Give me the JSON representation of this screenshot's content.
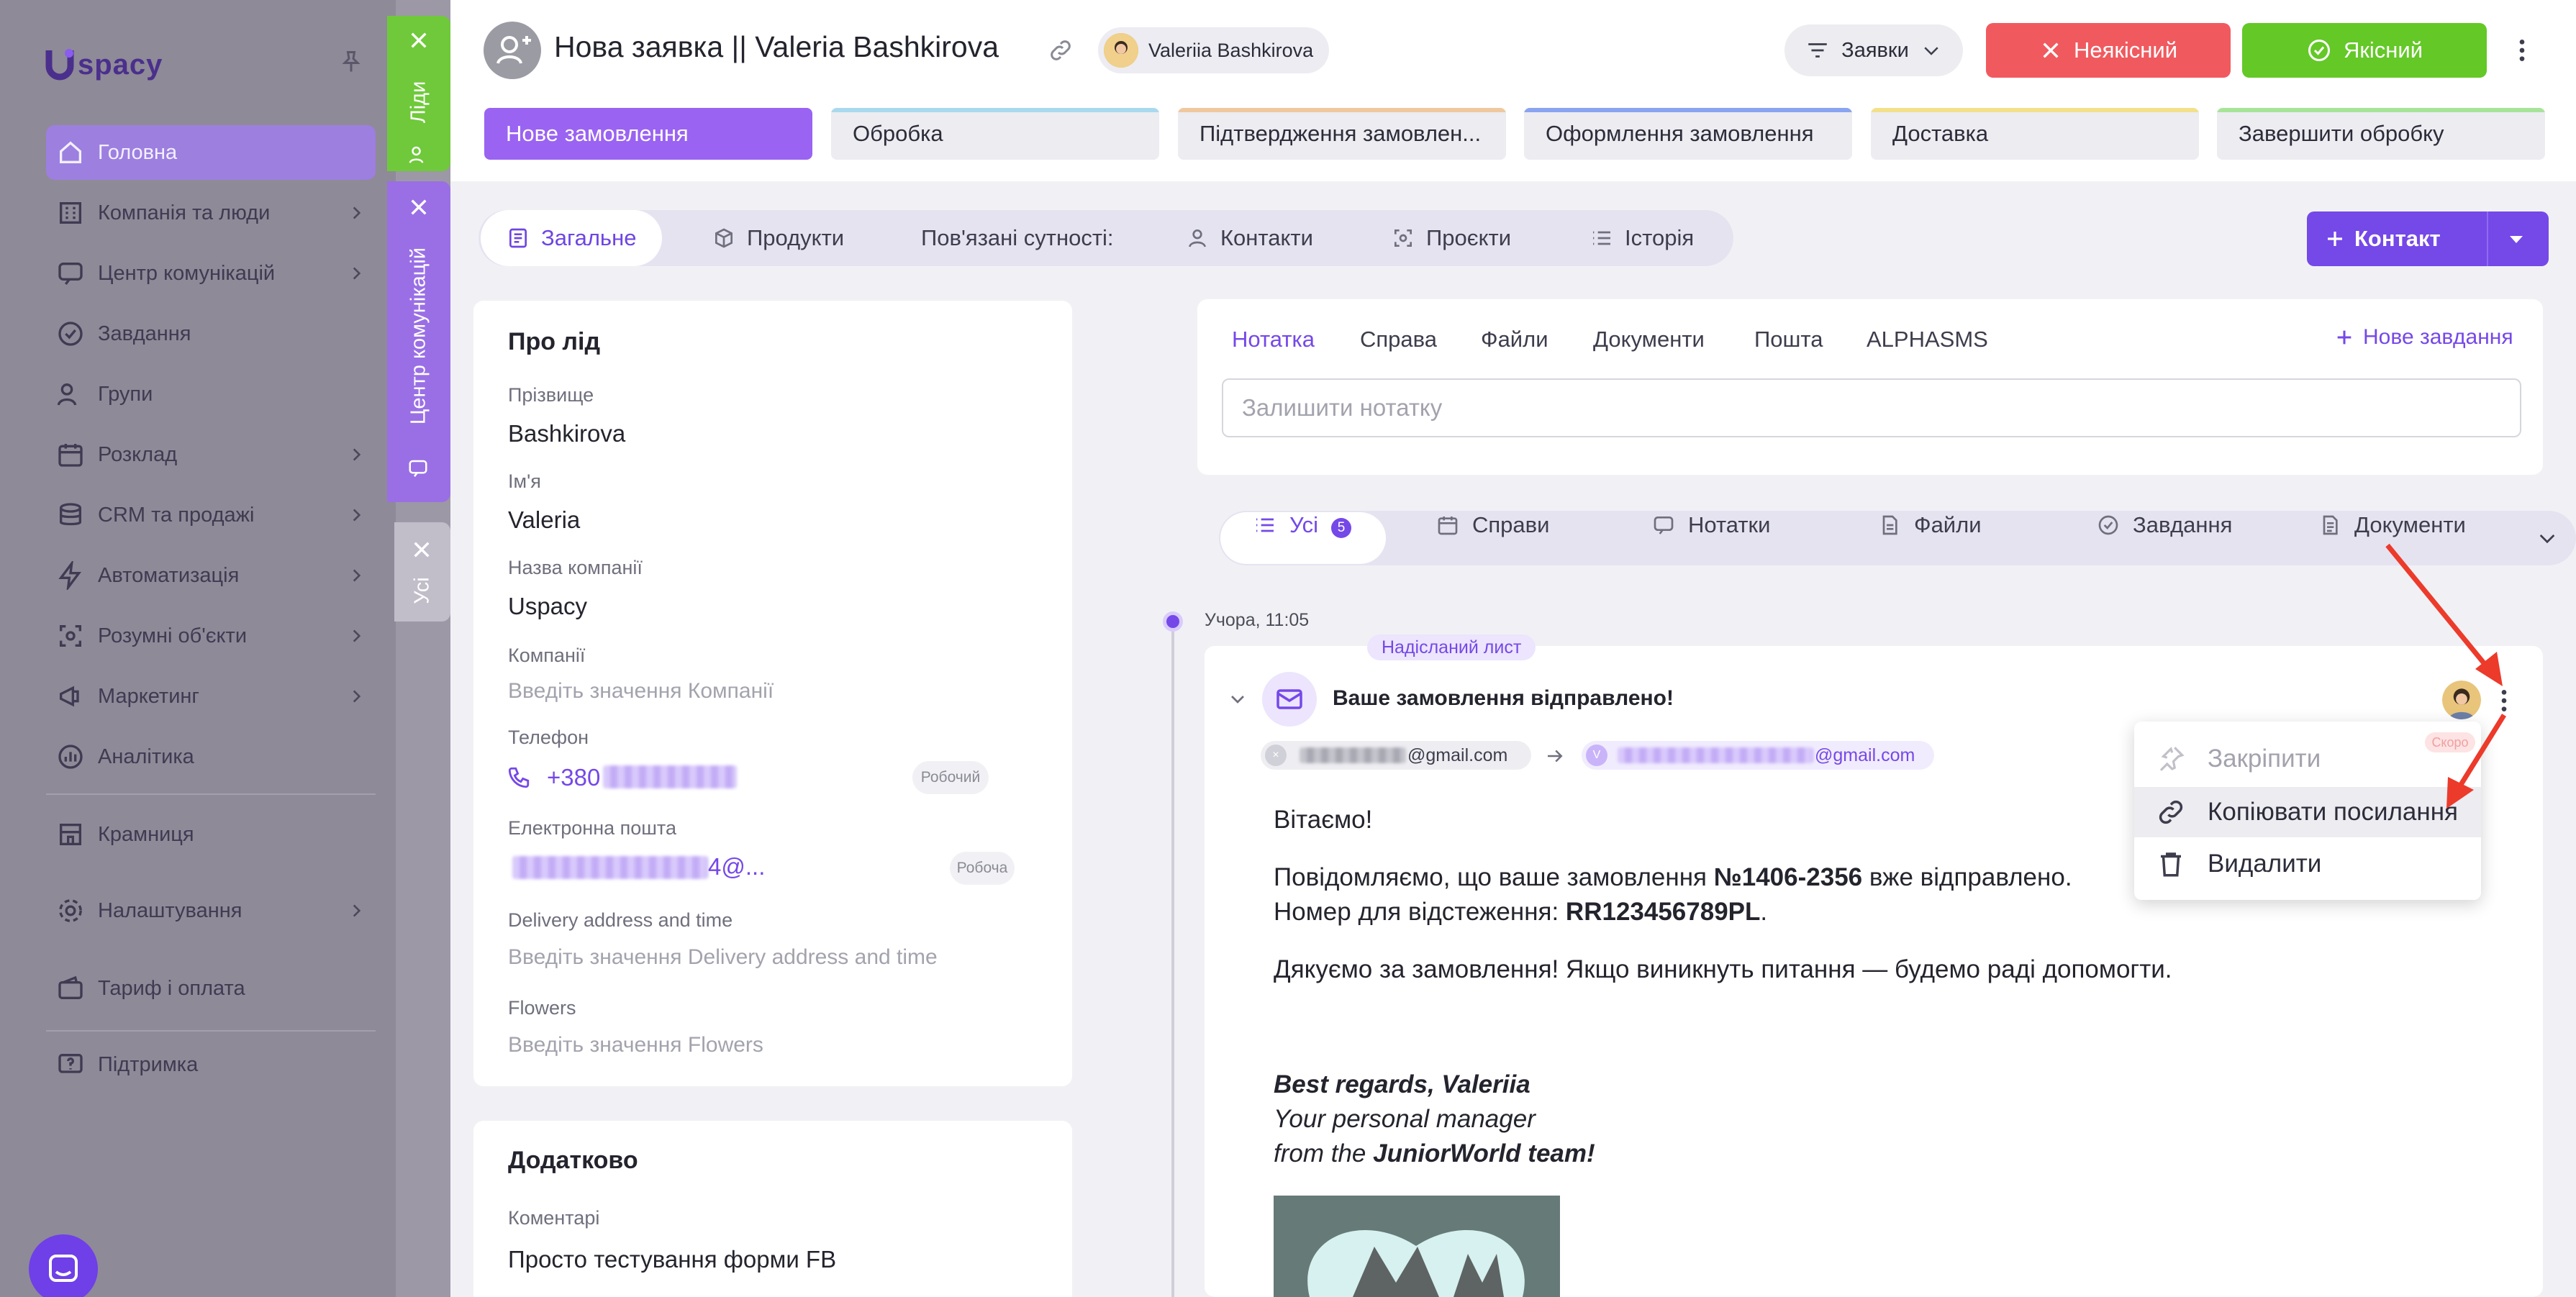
{
  "app": {
    "logo_text": "spacy"
  },
  "sidebar": {
    "items": [
      {
        "label": "Головна",
        "icon": "home-icon",
        "chevron": false,
        "active": true
      },
      {
        "label": "Компанія та люди",
        "icon": "building-icon",
        "chevron": true
      },
      {
        "label": "Центр комунікацій",
        "icon": "chat-icon",
        "chevron": true
      },
      {
        "label": "Завдання",
        "icon": "check-circle-icon",
        "chevron": false
      },
      {
        "label": "Групи",
        "icon": "users-icon",
        "chevron": false
      },
      {
        "label": "Розклад",
        "icon": "calendar-icon",
        "chevron": true
      },
      {
        "label": "CRM та продажі",
        "icon": "database-icon",
        "chevron": true
      },
      {
        "label": "Автоматизація",
        "icon": "lightning-icon",
        "chevron": true
      },
      {
        "label": "Розумні об'єкти",
        "icon": "smart-object-icon",
        "chevron": true
      },
      {
        "label": "Маркетинг",
        "icon": "marketing-icon",
        "chevron": true
      },
      {
        "label": "Аналітика",
        "icon": "chart-icon",
        "chevron": false
      },
      {
        "label": "Крамниця",
        "icon": "store-icon",
        "chevron": false
      },
      {
        "label": "Налаштування",
        "icon": "gear-icon",
        "chevron": true
      },
      {
        "label": "Тариф і оплата",
        "icon": "wallet-icon",
        "chevron": false
      },
      {
        "label": "Підтримка",
        "icon": "support-icon",
        "chevron": false
      }
    ]
  },
  "side_tabs": {
    "leads": {
      "label": "Ліди",
      "color": "#6fc93a"
    },
    "comm": {
      "label": "Центр комунікацій",
      "color": "#9a6fe5"
    },
    "all": {
      "label": "Усі",
      "color": "#b4b0bd"
    }
  },
  "header": {
    "title": "Нова заявка || Valeria Bashkirova",
    "user": "Valeriia Bashkirova",
    "funnel": "Заявки",
    "bad_button": "Неякісний",
    "good_button": "Якісний",
    "colors": {
      "bad": "#f05a5f",
      "good": "#64c827",
      "accent": "#7548e8"
    }
  },
  "stages": [
    {
      "label": "Нове замовлення",
      "color": "#9a63f2",
      "active": true
    },
    {
      "label": "Обробка",
      "color": "#a9d9ee"
    },
    {
      "label": "Підтвердження замовлен...",
      "color": "#f0c8a0"
    },
    {
      "label": "Оформлення замовлення",
      "color": "#8aa4f0"
    },
    {
      "label": "Доставка",
      "color": "#f3e08a"
    },
    {
      "label": "Завершити обробку",
      "color": "#a7e49a"
    }
  ],
  "tabs": {
    "general": "Загальне",
    "products": "Продукти",
    "related": "Пов'язані сутності:",
    "contacts": "Контакти",
    "projects": "Проєкти",
    "history": "Історія",
    "contact_button": "Контакт"
  },
  "about": {
    "title": "Про лід",
    "surname_label": "Прізвище",
    "surname": "Bashkirova",
    "name_label": "Ім'я",
    "name": "Valeria",
    "company_name_label": "Назва компанії",
    "company_name": "Uspacy",
    "companies_label": "Компанії",
    "companies_placeholder": "Введіть значення Компанії",
    "phone_label": "Телефон",
    "phone_prefix": "+380",
    "phone_type": "Робочий",
    "email_label": "Електронна пошта",
    "email_suffix": "4@...",
    "email_type": "Робоча",
    "delivery_label": "Delivery address and time",
    "delivery_placeholder": "Введіть значення Delivery address and time",
    "flowers_label": "Flowers",
    "flowers_placeholder": "Введіть значення Flowers"
  },
  "extra": {
    "title": "Додатково",
    "comments_label": "Коментарі",
    "comments": "Просто тестування форми FB"
  },
  "notes": {
    "tabs": [
      "Нотатка",
      "Справа",
      "Файли",
      "Документи",
      "Пошта",
      "ALPHASMS"
    ],
    "new_task": "Нове завдання",
    "placeholder": "Залишити нотатку"
  },
  "feed": {
    "filters": [
      "Усі",
      "Справи",
      "Нотатки",
      "Файли",
      "Завдання",
      "Документи"
    ],
    "all_count": "5",
    "timestamp": "Учора, 11:05",
    "badge": "Надісланий лист",
    "subject": "Ваше замовлення відправлено!",
    "from": "@gmail.com",
    "to": "@gmail.com",
    "to_initial": "V",
    "soon": "Скоро",
    "greeting": "Вітаємо!",
    "line1_pre": "Повідомляємо, що ваше замовлення ",
    "order": "№1406-2356",
    "line1_post": " вже відправлено.",
    "line2_pre": "Номер для відстеження: ",
    "tracking": "RR123456789PL",
    "line2_post": ".",
    "line3": "Дякуємо за замовлення! Якщо виникнуть питання — будемо раді допомогти.",
    "sig1": "Best regards, Valeriia",
    "sig2": "Your personal manager",
    "sig3_pre": "from the ",
    "sig3_team": "JuniorWorld team!"
  },
  "menu": {
    "pin": "Закріпити",
    "copy": "Копіювати посилання",
    "delete": "Видалити"
  }
}
